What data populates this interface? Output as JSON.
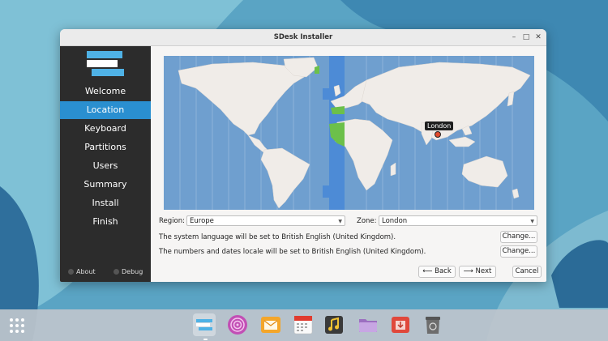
{
  "window": {
    "title": "SDesk Installer",
    "controls": {
      "minimize": "–",
      "maximize": "□",
      "close": "✕"
    }
  },
  "sidebar": {
    "items": [
      {
        "label": "Welcome",
        "active": false
      },
      {
        "label": "Location",
        "active": true
      },
      {
        "label": "Keyboard",
        "active": false
      },
      {
        "label": "Partitions",
        "active": false
      },
      {
        "label": "Users",
        "active": false
      },
      {
        "label": "Summary",
        "active": false
      },
      {
        "label": "Install",
        "active": false
      },
      {
        "label": "Finish",
        "active": false
      }
    ],
    "about_label": "About",
    "debug_label": "Debug"
  },
  "map": {
    "selected_city": "London",
    "colors": {
      "ocean": "#6f9fcf",
      "land": "#f0ece8",
      "selected_zone": "#4d8bd6",
      "highlight_land": "#6cc04a"
    }
  },
  "location": {
    "region_label": "Region:",
    "region_value": "Europe",
    "zone_label": "Zone:",
    "zone_value": "London",
    "language_text": "The system language will be set to British English (United Kingdom).",
    "locale_text": "The numbers and dates locale will be set to British English (United Kingdom).",
    "change_label": "Change...",
    "change_label_2": "Change..."
  },
  "buttons": {
    "back": "Back",
    "next": "Next",
    "cancel": "Cancel"
  },
  "taskbar": {
    "apps": [
      {
        "icon": "installer-icon",
        "active": true
      },
      {
        "icon": "browser-spiral-icon",
        "active": false
      },
      {
        "icon": "mail-icon",
        "active": false
      },
      {
        "icon": "calendar-icon",
        "active": false
      },
      {
        "icon": "music-icon",
        "active": false
      },
      {
        "icon": "files-icon",
        "active": false
      },
      {
        "icon": "software-store-icon",
        "active": false
      },
      {
        "icon": "trash-icon",
        "active": false
      }
    ]
  }
}
